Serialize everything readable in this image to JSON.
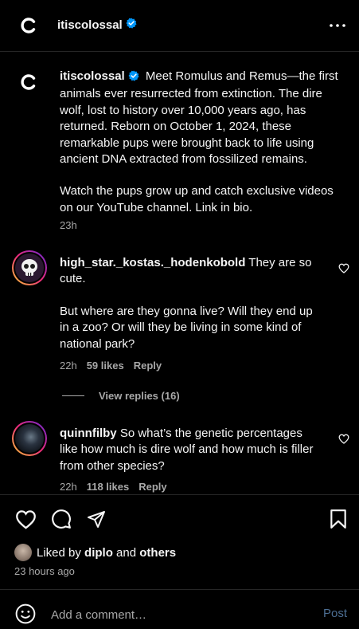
{
  "header": {
    "username": "itiscolossal",
    "more_icon": "more-horizontal-icon"
  },
  "post": {
    "author": "itiscolossal",
    "caption_p1": "Meet Romulus and Remus—the first animals ever resurrected from extinction. The dire wolf, lost to history over 10,000 years ago, has returned. Reborn on October 1, 2024, these remarkable pups were brought back to life using ancient DNA extracted from fossilized remains.",
    "caption_p2": "Watch the pups grow up and catch exclusive videos on our YouTube channel. Link in bio.",
    "time": "23h"
  },
  "comments": [
    {
      "username": "high_star._kostas._hodenkobold",
      "text_p1": "They are so cute.",
      "text_p2": "But where are they gonna live? Will they end up in a zoo? Or will they be living in some kind of national park?",
      "time": "22h",
      "likes": "59 likes",
      "reply": "Reply",
      "view_replies": "View replies (16)"
    },
    {
      "username": "quinnfilby",
      "text_p1": "So what’s the genetic percentages like how much is dire wolf and how much is filler from other species?",
      "time": "22h",
      "likes": "118 likes",
      "reply": "Reply"
    }
  ],
  "actions": {
    "like_icon": "heart-icon",
    "comment_icon": "comment-icon",
    "share_icon": "send-icon",
    "save_icon": "bookmark-icon"
  },
  "likes": {
    "prefix": "Liked by",
    "user": "diplo",
    "joiner": "and",
    "others": "others",
    "time": "23 hours ago"
  },
  "composer": {
    "placeholder": "Add a comment…",
    "post_label": "Post",
    "emoji_icon": "emoji-icon"
  },
  "colors": {
    "background": "#000000",
    "verified": "#0095f6",
    "post_button": "#4d6f94",
    "muted": "#a8a8a8",
    "separator": "#262626"
  }
}
